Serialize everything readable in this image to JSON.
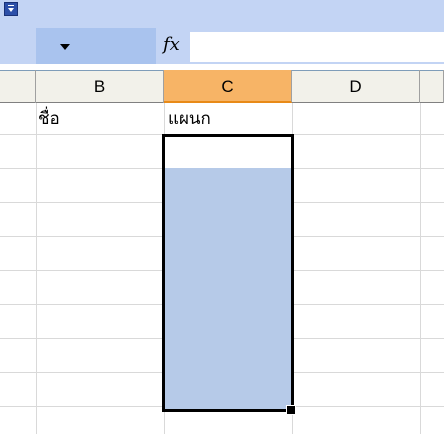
{
  "formula_bar": {
    "fx_label": "fx",
    "name_box": "",
    "formula": ""
  },
  "columns": [
    "B",
    "C",
    "D"
  ],
  "cells": {
    "B1": "ชื่อ",
    "C1": "แผนก"
  },
  "selection": {
    "active_column": "C"
  }
}
